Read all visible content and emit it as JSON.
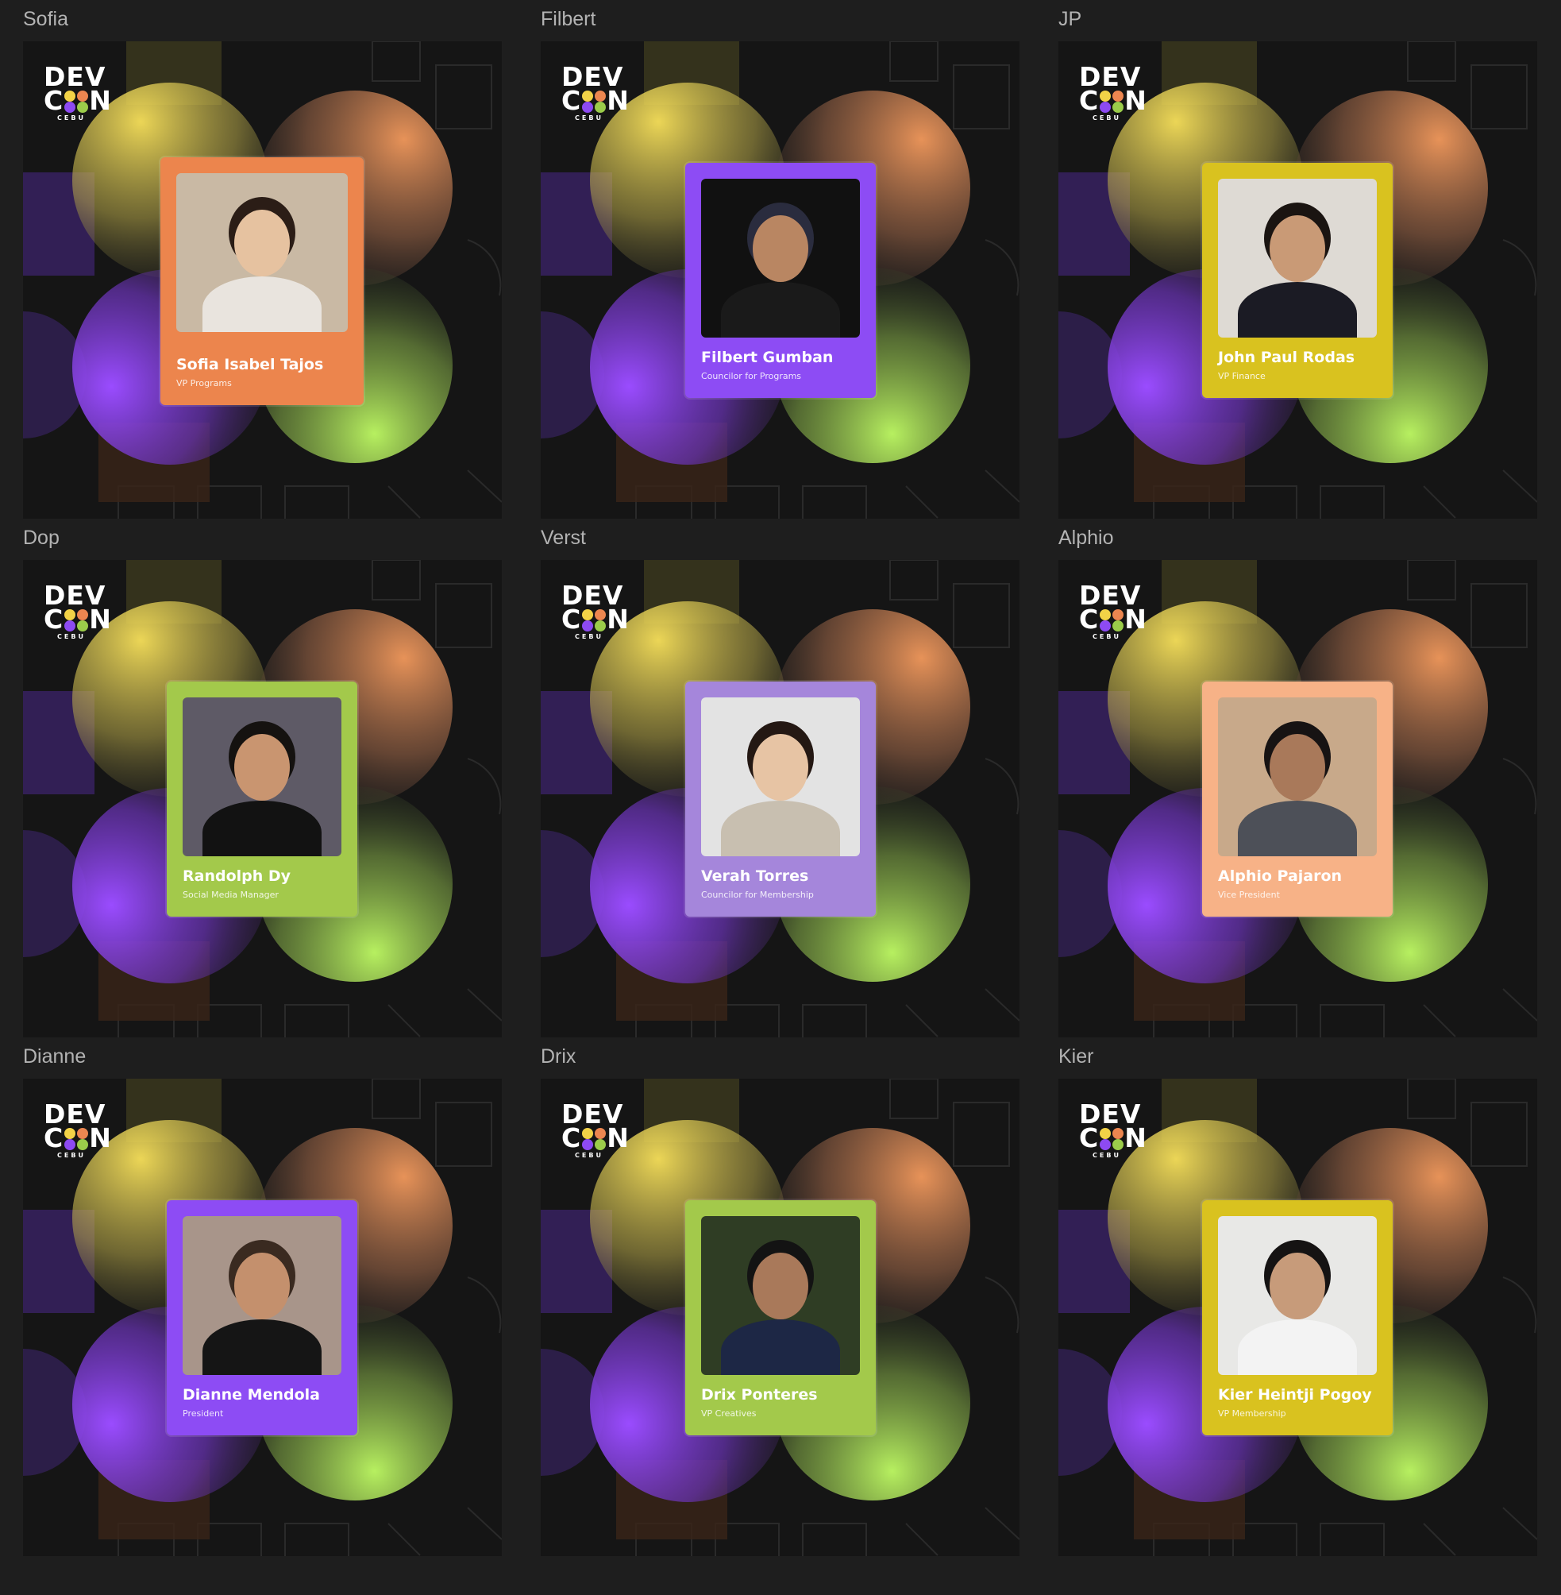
{
  "canvas": {
    "frames": [
      {
        "frame_label": "Sofia",
        "name": "Sofia Isabel Tajos",
        "role": "VP Programs",
        "card_color": "#ec854d",
        "photo_bg": "#c9b9a4",
        "skin": "#e6c2a0",
        "hair": "#2b1d16",
        "shirt": "#e9e4de"
      },
      {
        "frame_label": "Filbert",
        "name": "Filbert Gumban",
        "role": "Councilor for Programs",
        "card_color": "#8d4cf4",
        "photo_bg": "#111111",
        "skin": "#b98662",
        "hair": "#2a2c3e",
        "shirt": "#1a1a1a"
      },
      {
        "frame_label": "JP",
        "name": "John Paul Rodas",
        "role": "VP Finance",
        "card_color": "#d9c21f",
        "photo_bg": "#dedad4",
        "skin": "#c99a76",
        "hair": "#1a1411",
        "shirt": "#1b1b24"
      },
      {
        "frame_label": "Dop",
        "name": "Randolph Dy",
        "role": "Social Media Manager",
        "card_color": "#a3c94b",
        "photo_bg": "#5e5a66",
        "skin": "#c99570",
        "hair": "#151210",
        "shirt": "#121212"
      },
      {
        "frame_label": "Verst",
        "name": "Verah Torres",
        "role": "Councilor for Membership",
        "card_color": "#a586db",
        "photo_bg": "#e3e3e3",
        "skin": "#e7c4a4",
        "hair": "#241813",
        "shirt": "#c8bfb0"
      },
      {
        "frame_label": "Alphio",
        "name": "Alphio Pajaron",
        "role": "Vice President",
        "card_color": "#f7b287",
        "photo_bg": "#c8a98a",
        "skin": "#a9795a",
        "hair": "#171313",
        "shirt": "#4d5058"
      },
      {
        "frame_label": "Dianne",
        "name": "Dianne Mendola",
        "role": "President",
        "card_color": "#8d4cf4",
        "photo_bg": "#a8958a",
        "skin": "#c4906d",
        "hair": "#3a2a20",
        "shirt": "#151515"
      },
      {
        "frame_label": "Drix",
        "name": "Drix Ponteres",
        "role": "VP Creatives",
        "card_color": "#a3c94b",
        "photo_bg": "#2f3d24",
        "skin": "#a9795a",
        "hair": "#131313",
        "shirt": "#1d2745"
      },
      {
        "frame_label": "Kier",
        "name": "Kier Heintji Pogoy",
        "role": "VP Membership",
        "card_color": "#d9c21f",
        "photo_bg": "#e8e8e6",
        "skin": "#c79b7a",
        "hair": "#151313",
        "shirt": "#f3f3f3"
      }
    ],
    "logo": {
      "line1": "DEV",
      "line2_left": "C",
      "line2_right": "N",
      "line3": "CEBU"
    }
  }
}
